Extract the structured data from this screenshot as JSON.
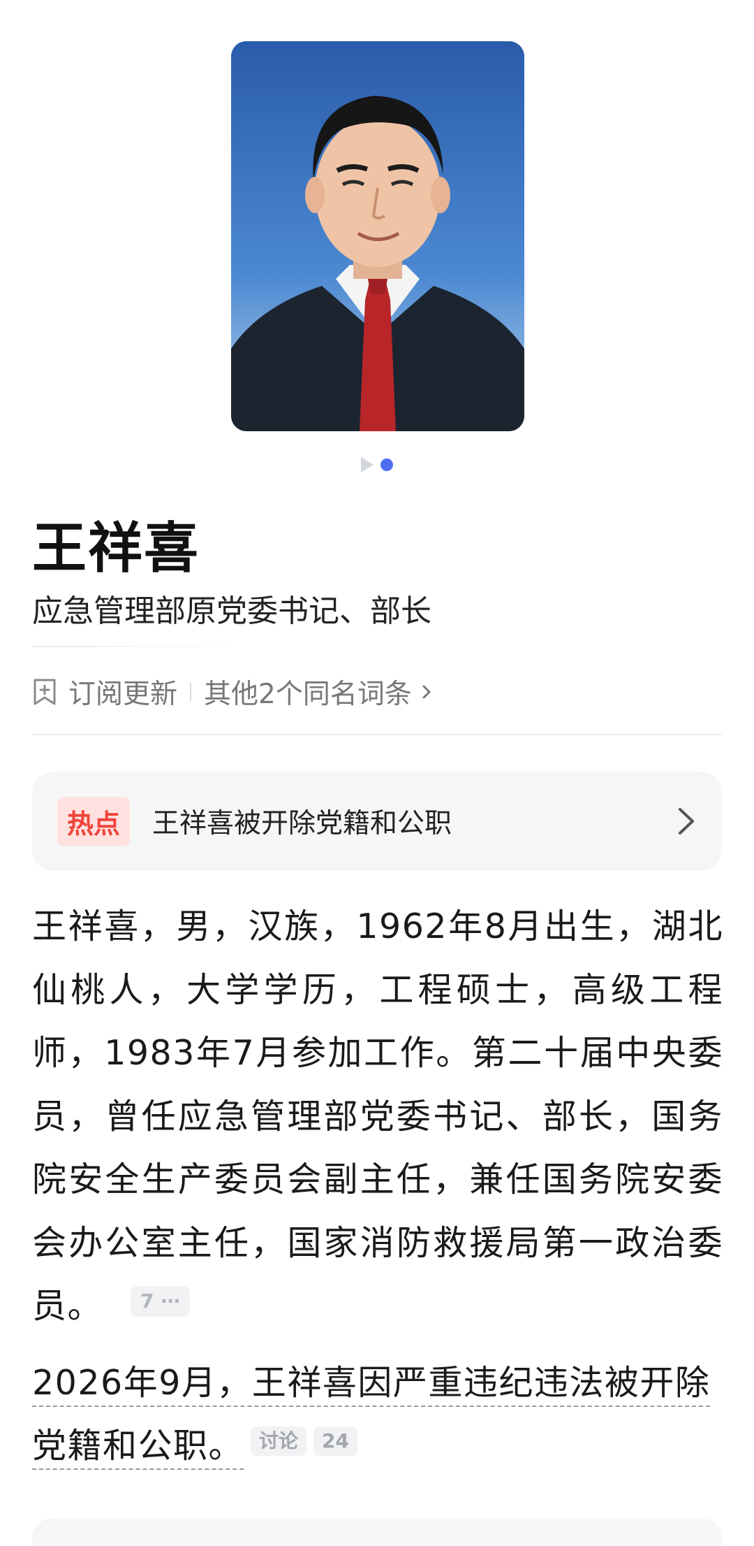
{
  "person": {
    "name": "王祥喜",
    "title": "应急管理部原党委书记、部长"
  },
  "actions": {
    "subscribe_label": "订阅更新",
    "same_name_label": "其他2个同名词条"
  },
  "hot": {
    "badge": "热点",
    "text": "王祥喜被开除党籍和公职"
  },
  "summary": {
    "text": "王祥喜，男，汉族，1962年8月出生，湖北仙桃人，大学学历，工程硕士，高级工程师，1983年7月参加工作。第二十届中央委员，曾任应急管理部党委书记、部长，国务院安全生产委员会副主任，兼任国务院安委会办公室主任，国家消防救援局第一政治委员。",
    "citation": "7 ⋯"
  },
  "news": {
    "text": "2026年9月，王祥喜因严重违纪违法被开除党籍和公职。",
    "discuss_label": "讨论",
    "discuss_count": "24"
  },
  "colors": {
    "accent": "#4e6ef2",
    "hot_red": "#f0443b",
    "hot_bg": "#ffe2e0"
  },
  "icons": {
    "subscribe": "bookmark-plus-icon",
    "same_name_arrow": "chevron-right-icon",
    "hot_arrow": "chevron-right-icon"
  }
}
